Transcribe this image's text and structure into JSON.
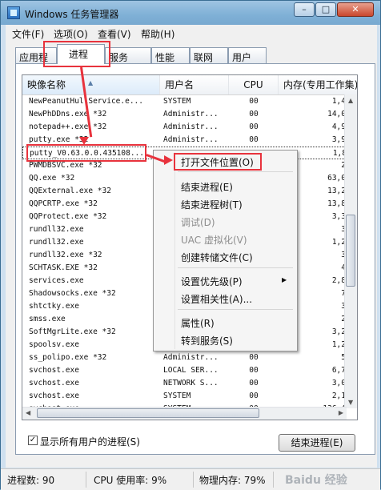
{
  "window": {
    "title": "Windows 任务管理器",
    "min_label": "–",
    "max_label": "□",
    "close_label": "✕"
  },
  "menu": [
    "文件(F)",
    "选项(O)",
    "查看(V)",
    "帮助(H)"
  ],
  "tabs": [
    "应用程序",
    "进程",
    "服务",
    "性能",
    "联网",
    "用户"
  ],
  "active_tab": "进程",
  "columns": [
    "映像名称",
    "用户名",
    "CPU",
    "内存(专用工作集)"
  ],
  "rows": [
    {
      "name": "NewPeanutHullService.e...",
      "user": "SYSTEM",
      "cpu": "00",
      "mem": "1,4"
    },
    {
      "name": "NewPhDDns.exe *32",
      "user": "Administr...",
      "cpu": "00",
      "mem": "14,0"
    },
    {
      "name": "notepad++.exe *32",
      "user": "Administr...",
      "cpu": "00",
      "mem": "4,9"
    },
    {
      "name": "putty.exe *32",
      "user": "Administr...",
      "cpu": "00",
      "mem": "3,9"
    },
    {
      "name": "putty_V0.63.0.0.435108...",
      "user": "",
      "cpu": "",
      "mem": "1,8"
    },
    {
      "name": "PWMDBSVC.exe *32",
      "user": "",
      "cpu": "",
      "mem": "2"
    },
    {
      "name": "QQ.exe *32",
      "user": "",
      "cpu": "",
      "mem": "63,0"
    },
    {
      "name": "QQExternal.exe *32",
      "user": "",
      "cpu": "",
      "mem": "13,2"
    },
    {
      "name": "QQPCRTP.exe *32",
      "user": "",
      "cpu": "",
      "mem": "13,8"
    },
    {
      "name": "QQProtect.exe *32",
      "user": "",
      "cpu": "",
      "mem": "3,3"
    },
    {
      "name": "rundll32.exe",
      "user": "",
      "cpu": "",
      "mem": "3"
    },
    {
      "name": "rundll32.exe",
      "user": "",
      "cpu": "",
      "mem": "1,2"
    },
    {
      "name": "rundll32.exe *32",
      "user": "",
      "cpu": "",
      "mem": "3"
    },
    {
      "name": "SCHTASK.EXE *32",
      "user": "",
      "cpu": "",
      "mem": "4"
    },
    {
      "name": "services.exe",
      "user": "",
      "cpu": "",
      "mem": "2,8"
    },
    {
      "name": "Shadowsocks.exe *32",
      "user": "",
      "cpu": "",
      "mem": "7"
    },
    {
      "name": "shtctky.exe",
      "user": "",
      "cpu": "",
      "mem": "3"
    },
    {
      "name": "smss.exe",
      "user": "",
      "cpu": "",
      "mem": "2"
    },
    {
      "name": "SoftMgrLite.exe *32",
      "user": "",
      "cpu": "",
      "mem": "3,2"
    },
    {
      "name": "spoolsv.exe",
      "user": "",
      "cpu": "",
      "mem": "1,2"
    },
    {
      "name": "ss_polipo.exe *32",
      "user": "Administr...",
      "cpu": "00",
      "mem": "5"
    },
    {
      "name": "svchost.exe",
      "user": "LOCAL SER...",
      "cpu": "00",
      "mem": "6,7"
    },
    {
      "name": "svchost.exe",
      "user": "NETWORK S...",
      "cpu": "00",
      "mem": "3,0"
    },
    {
      "name": "svchost.exe",
      "user": "SYSTEM",
      "cpu": "00",
      "mem": "2,1"
    },
    {
      "name": "svchost.exe",
      "user": "SYSTEM",
      "cpu": "00",
      "mem": "136,4"
    }
  ],
  "context_menu": {
    "open_location": "打开文件位置(O)",
    "end_process": "结束进程(E)",
    "end_tree": "结束进程树(T)",
    "debug": "调试(D)",
    "uac": "UAC 虚拟化(V)",
    "dump": "创建转储文件(C)",
    "priority": "设置优先级(P)",
    "affinity": "设置相关性(A)...",
    "properties": "属性(R)",
    "goto_service": "转到服务(S)",
    "submenu_arrow": "▶"
  },
  "show_all_users": {
    "label": "显示所有用户的进程(S)",
    "checked": true
  },
  "end_process_button": "结束进程(E)",
  "status": {
    "processes": "进程数: 90",
    "cpu": "CPU 使用率: 9%",
    "memory": "物理内存: 79%"
  },
  "watermark": "Baidu 经验",
  "colors": {
    "highlight": "#e8333d",
    "title_gradient": "#8fbbe0"
  }
}
